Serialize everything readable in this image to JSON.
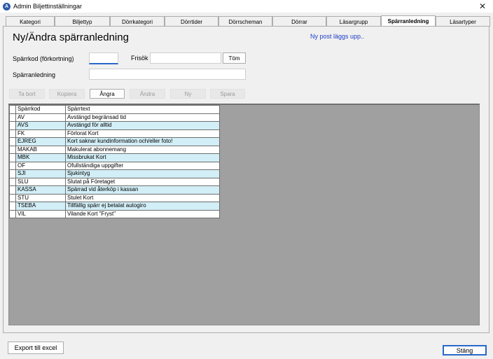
{
  "window": {
    "title": "Admin Biljettinställningar",
    "close_glyph": "✕"
  },
  "tabs": [
    {
      "label": "Kategori",
      "active": false
    },
    {
      "label": "Biljettyp",
      "active": false
    },
    {
      "label": "Dörrkategori",
      "active": false
    },
    {
      "label": "Dörrtider",
      "active": false
    },
    {
      "label": "Dörrscheman",
      "active": false
    },
    {
      "label": "Dörrar",
      "active": false
    },
    {
      "label": "Läsargrupp",
      "active": false
    },
    {
      "label": "Spärranledning",
      "active": true
    },
    {
      "label": "Läsartyper",
      "active": false
    }
  ],
  "form": {
    "heading": "Ny/Ändra spärranledning",
    "status_note": "Ny post läggs upp..",
    "code_label": "Spärrkod (förkortning)",
    "code_value": "",
    "search_label": "Frisök",
    "search_value": "",
    "clear_label": "Töm",
    "reason_label": "Spärranledning",
    "reason_value": ""
  },
  "toolbar": {
    "delete_label": "Ta bort",
    "copy_label": "Kopiera",
    "undo_label": "Ångra",
    "edit_label": "Ändra",
    "new_label": "Ny",
    "save_label": "Spara"
  },
  "grid": {
    "columns": [
      "Spärrkod",
      "Spärrtext"
    ],
    "rows": [
      [
        "AV",
        "Avstängd begränsad tid"
      ],
      [
        "AVS",
        "Avstängd för alltid"
      ],
      [
        "FK",
        "Förlorat Kort"
      ],
      [
        "EJREG",
        "Kort saknar kundinformation och/eller foto!"
      ],
      [
        "MAKAB",
        "Makulerat abonnemang"
      ],
      [
        "MBK",
        "Missbrukat Kort"
      ],
      [
        "OF",
        "Ofullständiga uppgifter"
      ],
      [
        "SJI",
        "Sjukintyg"
      ],
      [
        "SLU",
        "Slutat på Företaget"
      ],
      [
        "KASSA",
        "Spärrad vid återköp i kassan"
      ],
      [
        "STU",
        "Stulet Kort"
      ],
      [
        "TSEBA",
        "Tillfällig spärr ej betalat autogiro"
      ],
      [
        "VIL",
        "Vilande Kort \"Fryst\""
      ]
    ]
  },
  "footer": {
    "export_label": "Export till excel",
    "close_label": "Stäng"
  },
  "colors": {
    "accent": "#2a68c9",
    "status_note": "#1e3cc8",
    "row_alt": "#d2eef6"
  }
}
